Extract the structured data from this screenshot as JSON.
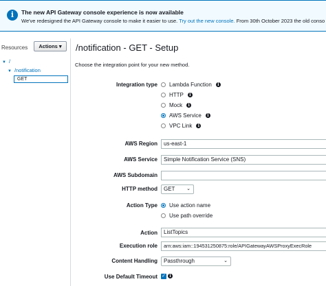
{
  "banner": {
    "title": "The new API Gateway console experience is now available",
    "text_before": "We've redesigned the API Gateway console to make it easier to use. ",
    "link": "Try out the new console.",
    "text_after": " From 30th October 2023 the old conso"
  },
  "sidebar": {
    "resources_label": "Resources",
    "actions_label": "Actions",
    "tree": [
      {
        "label": "/"
      },
      {
        "label": "/notification"
      },
      {
        "label": "GET"
      }
    ]
  },
  "main": {
    "title": "/notification - GET - Setup",
    "subtitle": "Choose the integration point for your new method.",
    "integration_type": {
      "label": "Integration type",
      "options": [
        {
          "label": "Lambda Function",
          "selected": false
        },
        {
          "label": "HTTP",
          "selected": false
        },
        {
          "label": "Mock",
          "selected": false
        },
        {
          "label": "AWS Service",
          "selected": true
        },
        {
          "label": "VPC Link",
          "selected": false
        }
      ]
    },
    "aws_region": {
      "label": "AWS Region",
      "value": "us-east-1"
    },
    "aws_service": {
      "label": "AWS Service",
      "value": "Simple Notification Service (SNS)"
    },
    "aws_subdomain": {
      "label": "AWS Subdomain",
      "value": ""
    },
    "http_method": {
      "label": "HTTP method",
      "value": "GET"
    },
    "action_type": {
      "label": "Action Type",
      "options": [
        {
          "label": "Use action name",
          "selected": true
        },
        {
          "label": "Use path override",
          "selected": false
        }
      ]
    },
    "action": {
      "label": "Action",
      "value": "ListTopics"
    },
    "execution_role": {
      "label": "Execution role",
      "value": "arn:aws:iam::194531250875:role/APIGatewayAWSProxyExecRole"
    },
    "content_handling": {
      "label": "Content Handling",
      "value": "Passthrough"
    },
    "default_timeout": {
      "label": "Use Default Timeout",
      "checked": true
    }
  },
  "colors": {
    "accent": "#0073bb",
    "banner_bg": "#f1faff"
  }
}
